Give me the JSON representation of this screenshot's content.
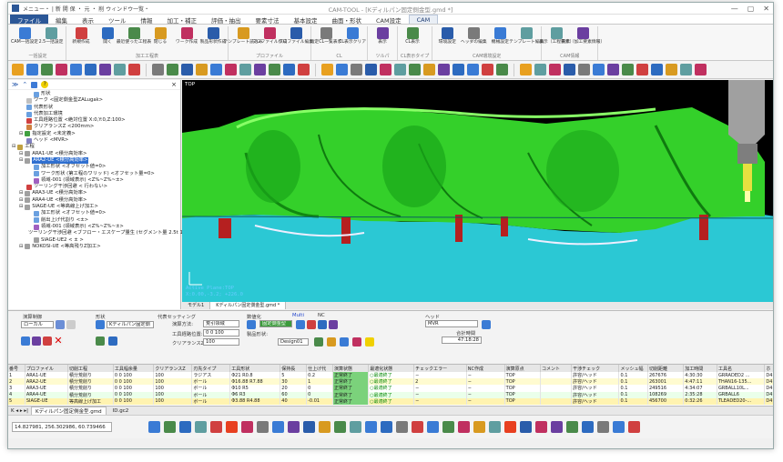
{
  "titlebar": {
    "quick_access": "メニュー・ | 新 開 保 ・ 元 ・ 削 ウィンドウ一覧・",
    "app_title": "CAM-TOOL - [Kディルパン固定側金型.gmd *]",
    "controls": [
      "—",
      "▢",
      "✕"
    ]
  },
  "tabs": [
    {
      "label": "ファイル"
    },
    {
      "label": "編集"
    },
    {
      "label": "表示"
    },
    {
      "label": "ツール"
    },
    {
      "label": "情報"
    },
    {
      "label": "加工・補正"
    },
    {
      "label": "評価・抽出"
    },
    {
      "label": "要素寸法"
    },
    {
      "label": "基本設定"
    },
    {
      "label": "曲面・形状"
    },
    {
      "label": "CAM設定"
    },
    {
      "label": "CAM"
    }
  ],
  "ribbon": {
    "groups": [
      {
        "label": "一括設定",
        "buttons": [
          "CAM一括設定",
          "2.5一括設定"
        ]
      },
      {
        "label": "加工工程表",
        "buttons": [
          "新規作成",
          "開く",
          "最近使った工程表",
          "閉じる",
          "ワーク作成",
          "製品形状作成"
        ]
      },
      {
        "label": "プロファイル",
        "buttons": [
          "テンプレート読込み",
          "プロファイル作成",
          "プロファイル編集"
        ]
      },
      {
        "label": "CL",
        "buttons": [
          "指定CL一覧表示",
          "CL表示クリア"
        ]
      },
      {
        "label": "ツルパ",
        "buttons": [
          "表示"
        ]
      },
      {
        "label": "CL表示タイプ",
        "buttons": [
          "CL表示"
        ]
      },
      {
        "label": "CAM環境設定",
        "buttons": [
          "環境設定",
          "ヘッダの編集",
          "機械設定",
          "テンプレート編集"
        ]
      },
      {
        "label": "CAM情報",
        "buttons": [
          "表示（工程要素）",
          "表示（加工要素情報）"
        ]
      }
    ]
  },
  "tree": {
    "items": [
      {
        "label": "形状",
        "indent": 3,
        "color": "#6aa0e0"
      },
      {
        "label": "ワーク <固定側金型ZALugak>",
        "indent": 2,
        "color": "#c0c0c0"
      },
      {
        "label": "代表形状",
        "indent": 2,
        "color": "#6aa0e0"
      },
      {
        "label": "代表加工環境",
        "indent": 2,
        "color": "#6aa0e0"
      },
      {
        "label": "工具経路位置 <絶対位置 X:0,Y:0,Z:100>",
        "indent": 2,
        "color": "#d04040"
      },
      {
        "label": "クリアランスZ <200mm>",
        "indent": 2,
        "color": "#d08040"
      },
      {
        "label": "指定設定 <未定義>",
        "indent": 1,
        "color": "#40a040"
      },
      {
        "label": "ヘッド <MVR>",
        "indent": 2,
        "color": "#8080c0"
      },
      {
        "label": "工程",
        "indent": 0,
        "color": "#c0a040"
      },
      {
        "label": "ARA1-UE <積分高効率>",
        "indent": 1,
        "color": "#a0a0a0"
      },
      {
        "label": "ARA2-UE <積分高効率>",
        "indent": 1,
        "color": "#a0a0a0",
        "selected": true
      },
      {
        "label": "加工形状 <オフセット値=0>",
        "indent": 3,
        "color": "#6aa0e0"
      },
      {
        "label": "ワーク形状 (第工程のワリッド) <オフセット量=0>",
        "indent": 3,
        "color": "#6aa0e0"
      },
      {
        "label": "領域-001 (領域表示) <Z%~Z%~±>",
        "indent": 3,
        "color": "#a060c0"
      },
      {
        "label": "ツーリング干渉回避 < 行わない>",
        "indent": 2,
        "color": "#d04040"
      },
      {
        "label": "ARA3-UE <積分高効率>",
        "indent": 1,
        "color": "#a0a0a0"
      },
      {
        "label": "ARA4-UE <積分高効率>",
        "indent": 1,
        "color": "#a0a0a0"
      },
      {
        "label": "SIAGE-UE <等高線上げ加工>",
        "indent": 1,
        "color": "#a0a0a0"
      },
      {
        "label": "加工形状 <オフセット値=0>",
        "indent": 3,
        "color": "#6aa0e0"
      },
      {
        "label": "削出上げ代割り <±>",
        "indent": 3,
        "color": "#6aa0e0"
      },
      {
        "label": "領域-001 (領域表示) <Z%~Z%~±>",
        "indent": 3,
        "color": "#a060c0"
      },
      {
        "label": "ツーリング干渉回避 <ブフロー・エスケープ量生 (セグメント量 2.5t 1+)>",
        "indent": 2,
        "color": "#d04040"
      },
      {
        "label": "SIAGE-UE2 < ± >",
        "indent": 3,
        "color": "#a0a0a0"
      },
      {
        "label": "NOKOSI-UE <等高残りZ加工>",
        "indent": 1,
        "color": "#a0a0a0"
      }
    ]
  },
  "viewport": {
    "view_label": "TOP",
    "status_lines": [
      "Active Plane:TOP",
      "X:0.00,-3.2; +226.0"
    ]
  },
  "doc_tabs": [
    {
      "label": "モデル1",
      "active": false
    },
    {
      "label": "Kディルパン固定側金型.gmd *",
      "active": true
    }
  ],
  "lower": {
    "sec_machine": "演算制御",
    "machine_value": "ローカル",
    "sec_shape": "形状",
    "shape_value": "Kディルパン固定側",
    "sec_tool": "代表セッティング",
    "tool_type_label": "演算方法:",
    "tool_type_value": "荒引領域",
    "tool_pos_label": "工具経路位置:",
    "tool_pos_value": "0 0 100",
    "clearance_label": "クリアランスZ:",
    "clearance_value": "100",
    "sec_area": "数値化",
    "area_name": "固定側金型",
    "sec_multi": "Multi",
    "sec_no": "NC",
    "area_pos_label": "製品形状:",
    "area_pos_value": "Design01",
    "sec_head": "ヘッド",
    "head_value": "MVR",
    "sec_time": "合計時間",
    "time_value": "47:18:28"
  },
  "table": {
    "headers": [
      "番号",
      "プロファイル",
      "切削工程",
      "工具幅余量",
      "クリアランスZ",
      "刃先タイプ",
      "工具形状",
      "保持長",
      "仕上げ代",
      "演算状態",
      "最適化状態",
      "チェックエラー",
      "NC作成",
      "演算原点",
      "コメント",
      "干渉チェック",
      "メッシュ幅",
      "切削距離",
      "加工時間",
      "工具名",
      "ホ"
    ],
    "rows": [
      [
        "1",
        "ARA1-UE",
        "積分荒削り",
        "0 0 100",
        "100",
        "ラジアス",
        "Φ21 R0.8",
        "5",
        "0.2",
        "正常終了",
        "○最適終了",
        "−",
        "−",
        "TOP",
        "",
        "許容/ヘッド",
        "0.1",
        "267676",
        "4:30:30",
        "GRRADED2 ...",
        "D4"
      ],
      [
        "2",
        "ARA2-UE",
        "積分荒削り",
        "0 0 100",
        "100",
        "ボール",
        "Φ16.88 R7.88",
        "30",
        "1",
        "正常終了",
        "○最適終了",
        "2",
        "−",
        "TOP",
        "",
        "許容/ヘッド",
        "0.1",
        "263001",
        "4:47:11",
        "THAN16-135...",
        "D4"
      ],
      [
        "3",
        "ARA3-UE",
        "積分荒削り",
        "0 0 100",
        "100",
        "ボール",
        "Φ10 R5",
        "20",
        "0",
        "正常終了",
        "○最適終了",
        "−",
        "−",
        "TOP",
        "",
        "許容/ヘッド",
        "0.1",
        "249516",
        "4:34:07",
        "GRBALL10L...",
        "D4"
      ],
      [
        "4",
        "ARA4-UE",
        "積分荒削り",
        "0 0 100",
        "100",
        "ボール",
        "Φ6 R3",
        "60",
        "0",
        "正常終了",
        "○最適終了",
        "−",
        "−",
        "TOP",
        "",
        "許容/ヘッド",
        "0.1",
        "108269",
        "2:35:28",
        "GRBALL6",
        "D4"
      ],
      [
        "5",
        "SIAGE-UE",
        "等高線上げ加工",
        "0 0 100",
        "100",
        "ボール",
        "Φ3.88 R4.88",
        "40",
        "-0.01",
        "正常終了",
        "○最適終了",
        "−",
        "−",
        "TOP",
        "",
        "許容/ヘッド",
        "0.1",
        "456700",
        "0:32:26",
        "TLEADED20-...",
        "D4"
      ]
    ]
  },
  "sheets": {
    "nav": "K ◂ ▸ ▸|",
    "tabs": [
      "Kディルパン固定側金型.gmd",
      "ID.gc2"
    ]
  },
  "statusbar": {
    "coords": "14.827981, 256.302986, 60.739466"
  },
  "colors": {
    "viewport_bg": "#000000",
    "model_green": "#33dd33",
    "model_cyan": "#33ccdd",
    "tool_holder": "#a0a0a0",
    "tool_tip": "#e6e040",
    "selection": "#2f6fd0",
    "file_tab": "#2b5797"
  }
}
